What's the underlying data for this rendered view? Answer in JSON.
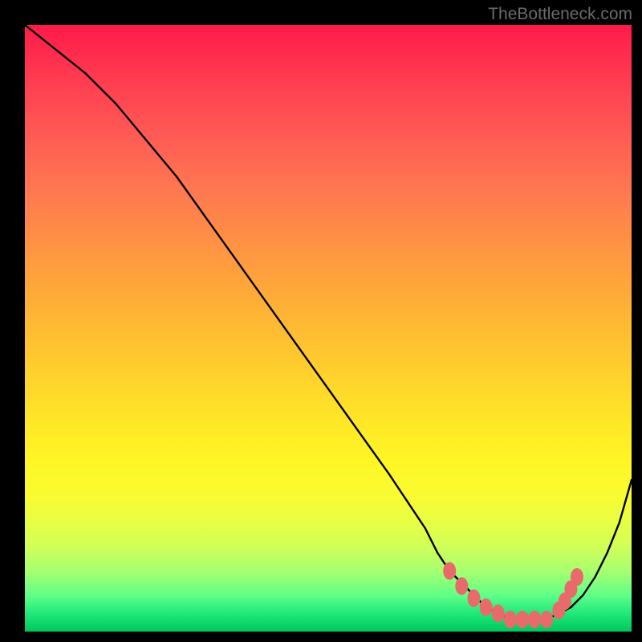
{
  "watermark": "TheBottleneck.com",
  "chart_data": {
    "type": "line",
    "title": "",
    "xlabel": "",
    "ylabel": "",
    "xlim": [
      0,
      100
    ],
    "ylim": [
      0,
      100
    ],
    "series": [
      {
        "name": "bottleneck-curve",
        "x": [
          0,
          5,
          10,
          15,
          20,
          25,
          30,
          35,
          40,
          45,
          50,
          55,
          60,
          62,
          64,
          66,
          68,
          70,
          72,
          74,
          76,
          78,
          80,
          82,
          84,
          86,
          88,
          90,
          92,
          94,
          96,
          98,
          100
        ],
        "y": [
          100,
          96,
          92,
          87,
          81,
          75,
          68,
          61,
          54,
          47,
          40,
          33,
          26,
          23,
          20,
          17,
          13,
          10,
          8,
          6,
          4,
          3,
          2,
          2,
          2,
          2,
          3,
          4,
          6,
          9,
          13,
          18,
          25
        ]
      }
    ],
    "markers": {
      "name": "highlight-dots",
      "color": "#e86a6a",
      "points": [
        {
          "x": 70,
          "y": 10
        },
        {
          "x": 72,
          "y": 7.5
        },
        {
          "x": 74,
          "y": 5.5
        },
        {
          "x": 76,
          "y": 4
        },
        {
          "x": 78,
          "y": 3
        },
        {
          "x": 80,
          "y": 2
        },
        {
          "x": 82,
          "y": 2
        },
        {
          "x": 84,
          "y": 2
        },
        {
          "x": 86,
          "y": 2
        },
        {
          "x": 88,
          "y": 3.5
        },
        {
          "x": 89,
          "y": 5
        },
        {
          "x": 90,
          "y": 7
        },
        {
          "x": 91,
          "y": 9
        }
      ]
    }
  }
}
